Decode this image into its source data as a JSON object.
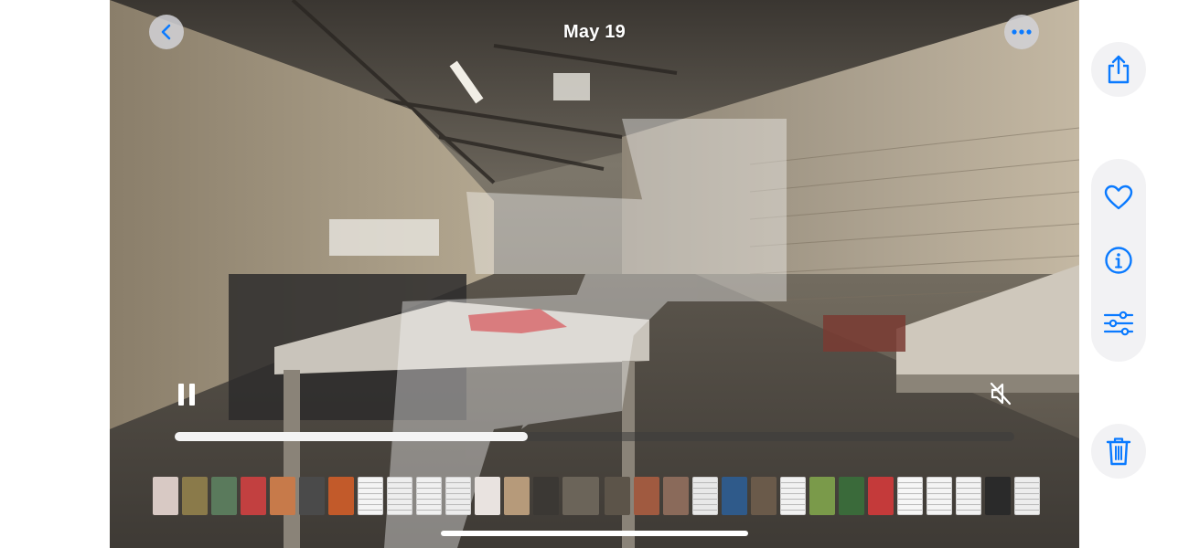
{
  "header": {
    "date_title": "May 19"
  },
  "icons": {
    "back": "chevron-left-icon",
    "more": "ellipsis-icon",
    "share": "share-icon",
    "favorite": "heart-icon",
    "info": "info-icon",
    "adjust": "sliders-icon",
    "delete": "trash-icon",
    "pause": "pause-icon",
    "mute": "speaker-muted-icon"
  },
  "colors": {
    "accent": "#0a7aff",
    "sidebar_button_bg": "#f2f2f4",
    "scrubber_fill": "#f4f4f4"
  },
  "playback": {
    "state": "playing",
    "muted": true,
    "progress": 0.42
  },
  "thumbnails": [
    {
      "type": "photo",
      "color": "#d8c9c4"
    },
    {
      "type": "photo",
      "color": "#8a7a4a"
    },
    {
      "type": "photo",
      "color": "#5a7a5c"
    },
    {
      "type": "photo",
      "color": "#c24040"
    },
    {
      "type": "photo",
      "color": "#c77a4a"
    },
    {
      "type": "photo",
      "color": "#4a4a4a"
    },
    {
      "type": "photo",
      "color": "#c25a2a"
    },
    {
      "type": "document",
      "color": "#f4f4f4"
    },
    {
      "type": "document",
      "color": "#eeeeee"
    },
    {
      "type": "document",
      "color": "#f0f0f0"
    },
    {
      "type": "document",
      "color": "#ececec"
    },
    {
      "type": "photo",
      "color": "#e9e3e0"
    },
    {
      "type": "photo",
      "color": "#b69a7a"
    },
    {
      "type": "photo",
      "color": "#3b3834"
    },
    {
      "type": "video-current",
      "color": "#6b6459"
    },
    {
      "type": "photo",
      "color": "#5c5449"
    },
    {
      "type": "photo",
      "color": "#a05a40"
    },
    {
      "type": "photo",
      "color": "#8a6a5a"
    },
    {
      "type": "document",
      "color": "#e8e8e8"
    },
    {
      "type": "photo",
      "color": "#2f5a8a"
    },
    {
      "type": "photo",
      "color": "#6a5a4a"
    },
    {
      "type": "document",
      "color": "#f1f1f1"
    },
    {
      "type": "photo",
      "color": "#7a9a4a"
    },
    {
      "type": "photo",
      "color": "#3a6a3a"
    },
    {
      "type": "photo",
      "color": "#c43a3a"
    },
    {
      "type": "document",
      "color": "#f6f6f6"
    },
    {
      "type": "document",
      "color": "#f4f4f4"
    },
    {
      "type": "document",
      "color": "#f2f2f2"
    },
    {
      "type": "photo",
      "color": "#2a2a2a"
    },
    {
      "type": "document",
      "color": "#ededed"
    }
  ]
}
